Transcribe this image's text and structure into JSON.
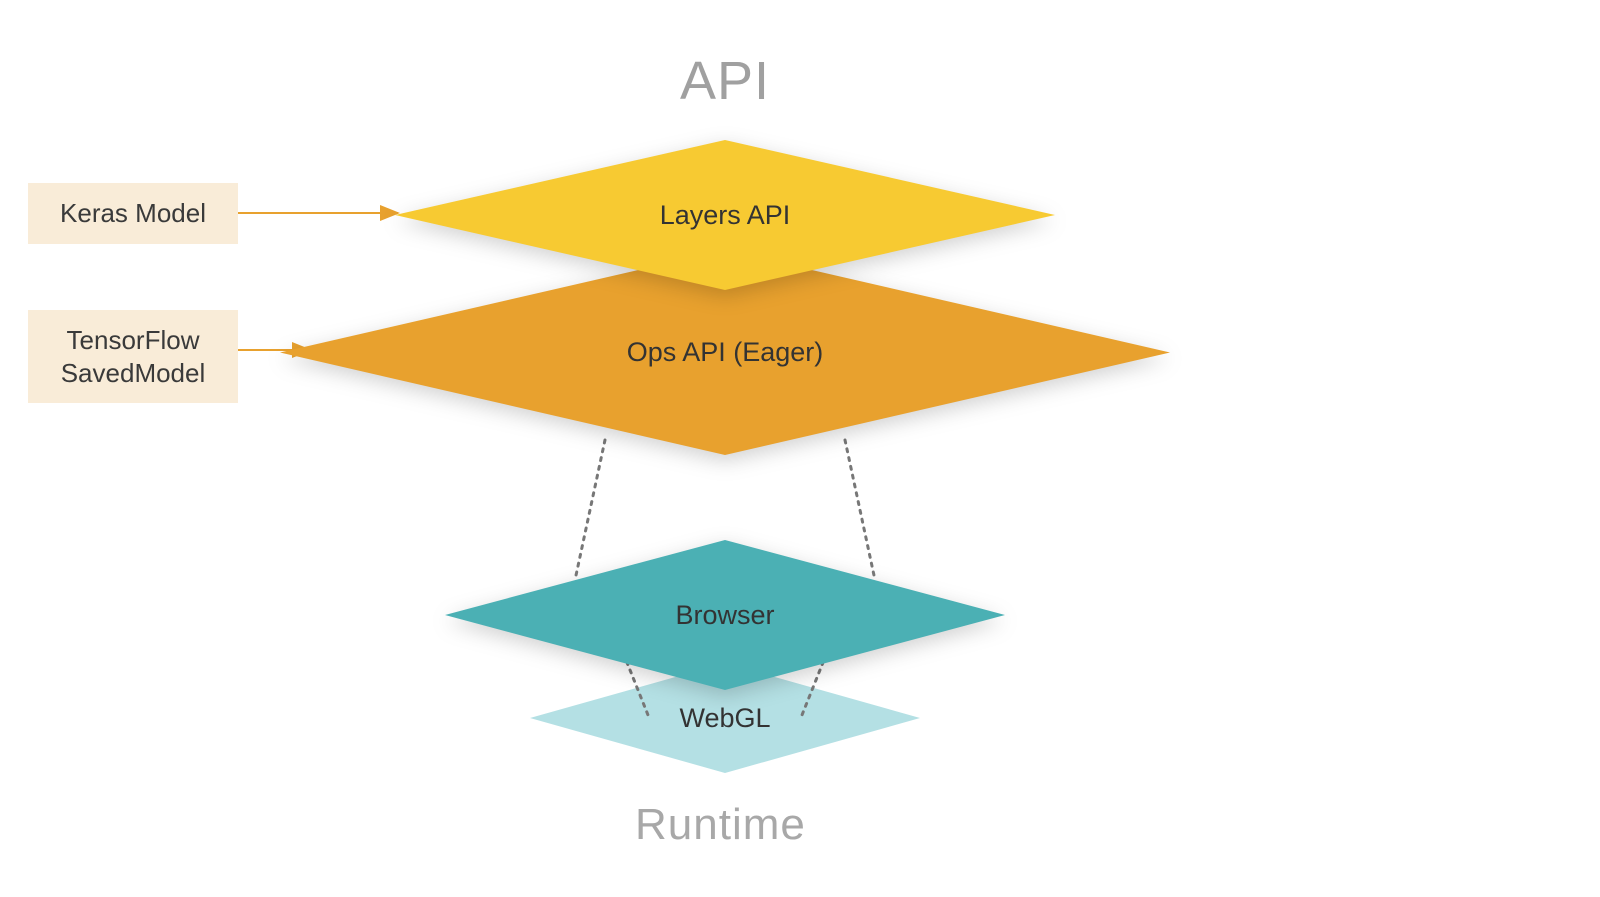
{
  "titles": {
    "top": "API",
    "bottom": "Runtime"
  },
  "boxes": {
    "keras": "Keras Model",
    "tf_line1": "TensorFlow",
    "tf_line2": "SavedModel"
  },
  "layers": {
    "layers_api": "Layers API",
    "ops_api": "Ops API (Eager)",
    "browser": "Browser",
    "webgl": "WebGL"
  },
  "colors": {
    "yellow": "#f7ca32",
    "orange": "#e8a12e",
    "teal": "#4bb0b4",
    "lightteal": "#b4e0e4",
    "cream": "#f9ecd8",
    "arrow": "#e8a12e"
  }
}
